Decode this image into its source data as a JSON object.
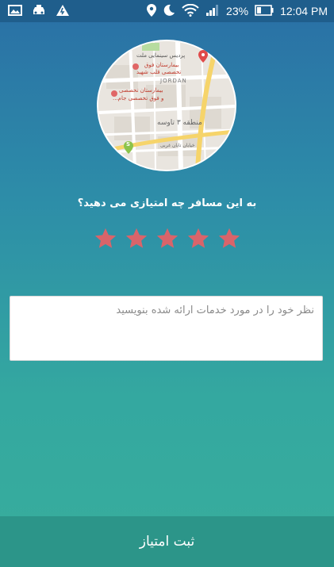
{
  "status_bar": {
    "battery": "23%",
    "time": "12:04 PM",
    "left_icons": [
      "image-icon",
      "taxi-icon",
      "signal-alert-icon"
    ],
    "right_icons": [
      "location-icon",
      "moon-icon",
      "wifi-icon",
      "cell-signal-icon",
      "battery-icon"
    ]
  },
  "map": {
    "labels": {
      "park": "پردیس سینمایی ملت",
      "hospital1": "بیمارستان فوق",
      "hospital1b": "تخصصی قلب شهید",
      "district_en": "JORDAN",
      "hospital2": "بیمارستان تخصصی",
      "hospital2b": "و فوق تخصصی جام...",
      "zone": "منطقه ۳ تاوسه",
      "street": "خیابان تابان غربی"
    },
    "marker_top": "red-pin",
    "marker_bottom_label": "S"
  },
  "rating": {
    "question": "به این مسافر چه امتیازی می دهید؟",
    "max": 5,
    "selected": 5,
    "star_color": "#d9646a"
  },
  "comment": {
    "placeholder": "نظر خود را در مورد خدمات ارائه شده بنویسید",
    "value": ""
  },
  "submit": {
    "label": "ثبت امتیاز"
  }
}
